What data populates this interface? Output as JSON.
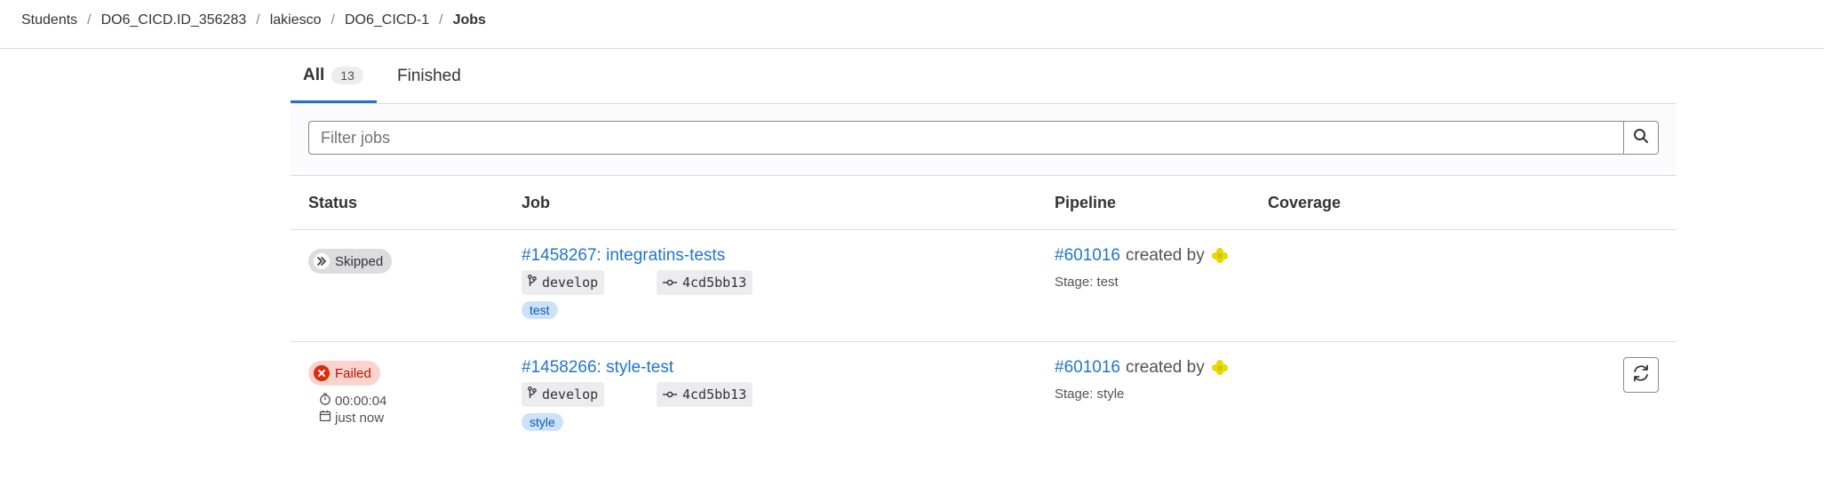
{
  "breadcrumb": {
    "items": [
      "Students",
      "DO6_CICD.ID_356283",
      "lakiesco",
      "DO6_CICD-1"
    ],
    "current": "Jobs",
    "separator": "/"
  },
  "tabs": {
    "all_label": "All",
    "all_count": "13",
    "finished_label": "Finished"
  },
  "filter": {
    "placeholder": "Filter jobs",
    "search_icon": "search-icon"
  },
  "table": {
    "columns": {
      "status": "Status",
      "job": "Job",
      "pipeline": "Pipeline",
      "coverage": "Coverage"
    },
    "rows": [
      {
        "status": "Skipped",
        "status_icon": "skipped-icon",
        "job_link": "#1458267: integratins-tests",
        "branch": "develop",
        "commit": "4cd5bb13",
        "tag": "test",
        "pipeline_link": "#601016",
        "created_by": "created by",
        "stage": "Stage: test"
      },
      {
        "status": "Failed",
        "status_icon": "failed-icon",
        "duration": "00:00:04",
        "finished": "just now",
        "job_link": "#1458266: style-test",
        "branch": "develop",
        "commit": "4cd5bb13",
        "tag": "style",
        "pipeline_link": "#601016",
        "created_by": "created by",
        "stage": "Stage: style",
        "action_icon": "retry-icon"
      }
    ]
  },
  "colors": {
    "link": "#1f75cb",
    "failed_bg": "#fdd4cd",
    "failed_text": "#ae1800",
    "skipped_bg": "#dcdcde",
    "tag_bg": "#cbe2f9",
    "avatar": "#e8d900"
  }
}
